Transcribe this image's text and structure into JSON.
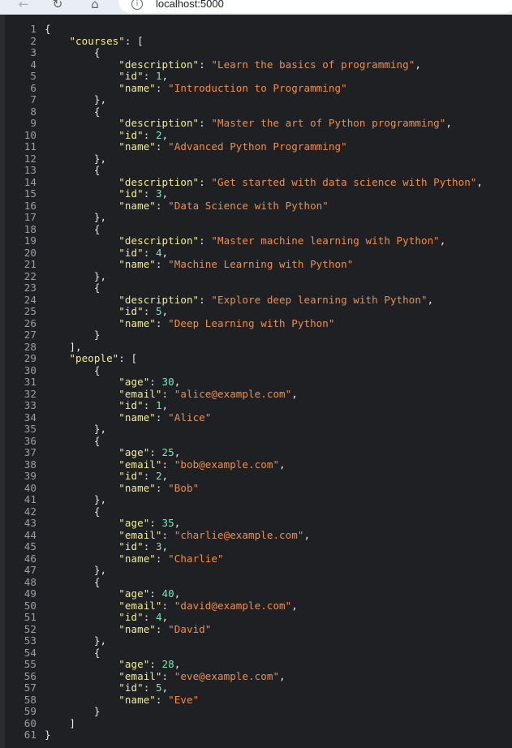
{
  "browser": {
    "url": "localhost:5000",
    "icons": {
      "back": "arrow-left",
      "reload": "reload",
      "home": "home",
      "info": "info"
    }
  },
  "colors": {
    "background": "#1f2023",
    "key": "#f2ee8f",
    "string": "#ef8f4a",
    "number": "#7ee8b9",
    "punctuation": "#e8eaed",
    "line_number": "#9aa0a6"
  },
  "json_viewer": {
    "lines": [
      [
        {
          "t": "p",
          "v": "{"
        }
      ],
      [
        {
          "t": "p",
          "v": "    "
        },
        {
          "t": "k",
          "v": "\"courses\""
        },
        {
          "t": "p",
          "v": ": ["
        }
      ],
      [
        {
          "t": "p",
          "v": "        {"
        }
      ],
      [
        {
          "t": "p",
          "v": "            "
        },
        {
          "t": "k",
          "v": "\"description\""
        },
        {
          "t": "p",
          "v": ": "
        },
        {
          "t": "s",
          "v": "\"Learn the basics of programming\""
        },
        {
          "t": "p",
          "v": ","
        }
      ],
      [
        {
          "t": "p",
          "v": "            "
        },
        {
          "t": "k",
          "v": "\"id\""
        },
        {
          "t": "p",
          "v": ": "
        },
        {
          "t": "n",
          "v": "1"
        },
        {
          "t": "p",
          "v": ","
        }
      ],
      [
        {
          "t": "p",
          "v": "            "
        },
        {
          "t": "k",
          "v": "\"name\""
        },
        {
          "t": "p",
          "v": ": "
        },
        {
          "t": "s",
          "v": "\"Introduction to Programming\""
        }
      ],
      [
        {
          "t": "p",
          "v": "        },"
        }
      ],
      [
        {
          "t": "p",
          "v": "        {"
        }
      ],
      [
        {
          "t": "p",
          "v": "            "
        },
        {
          "t": "k",
          "v": "\"description\""
        },
        {
          "t": "p",
          "v": ": "
        },
        {
          "t": "s",
          "v": "\"Master the art of Python programming\""
        },
        {
          "t": "p",
          "v": ","
        }
      ],
      [
        {
          "t": "p",
          "v": "            "
        },
        {
          "t": "k",
          "v": "\"id\""
        },
        {
          "t": "p",
          "v": ": "
        },
        {
          "t": "n",
          "v": "2"
        },
        {
          "t": "p",
          "v": ","
        }
      ],
      [
        {
          "t": "p",
          "v": "            "
        },
        {
          "t": "k",
          "v": "\"name\""
        },
        {
          "t": "p",
          "v": ": "
        },
        {
          "t": "s",
          "v": "\"Advanced Python Programming\""
        }
      ],
      [
        {
          "t": "p",
          "v": "        },"
        }
      ],
      [
        {
          "t": "p",
          "v": "        {"
        }
      ],
      [
        {
          "t": "p",
          "v": "            "
        },
        {
          "t": "k",
          "v": "\"description\""
        },
        {
          "t": "p",
          "v": ": "
        },
        {
          "t": "s",
          "v": "\"Get started with data science with Python\""
        },
        {
          "t": "p",
          "v": ","
        }
      ],
      [
        {
          "t": "p",
          "v": "            "
        },
        {
          "t": "k",
          "v": "\"id\""
        },
        {
          "t": "p",
          "v": ": "
        },
        {
          "t": "n",
          "v": "3"
        },
        {
          "t": "p",
          "v": ","
        }
      ],
      [
        {
          "t": "p",
          "v": "            "
        },
        {
          "t": "k",
          "v": "\"name\""
        },
        {
          "t": "p",
          "v": ": "
        },
        {
          "t": "s",
          "v": "\"Data Science with Python\""
        }
      ],
      [
        {
          "t": "p",
          "v": "        },"
        }
      ],
      [
        {
          "t": "p",
          "v": "        {"
        }
      ],
      [
        {
          "t": "p",
          "v": "            "
        },
        {
          "t": "k",
          "v": "\"description\""
        },
        {
          "t": "p",
          "v": ": "
        },
        {
          "t": "s",
          "v": "\"Master machine learning with Python\""
        },
        {
          "t": "p",
          "v": ","
        }
      ],
      [
        {
          "t": "p",
          "v": "            "
        },
        {
          "t": "k",
          "v": "\"id\""
        },
        {
          "t": "p",
          "v": ": "
        },
        {
          "t": "n",
          "v": "4"
        },
        {
          "t": "p",
          "v": ","
        }
      ],
      [
        {
          "t": "p",
          "v": "            "
        },
        {
          "t": "k",
          "v": "\"name\""
        },
        {
          "t": "p",
          "v": ": "
        },
        {
          "t": "s",
          "v": "\"Machine Learning with Python\""
        }
      ],
      [
        {
          "t": "p",
          "v": "        },"
        }
      ],
      [
        {
          "t": "p",
          "v": "        {"
        }
      ],
      [
        {
          "t": "p",
          "v": "            "
        },
        {
          "t": "k",
          "v": "\"description\""
        },
        {
          "t": "p",
          "v": ": "
        },
        {
          "t": "s",
          "v": "\"Explore deep learning with Python\""
        },
        {
          "t": "p",
          "v": ","
        }
      ],
      [
        {
          "t": "p",
          "v": "            "
        },
        {
          "t": "k",
          "v": "\"id\""
        },
        {
          "t": "p",
          "v": ": "
        },
        {
          "t": "n",
          "v": "5"
        },
        {
          "t": "p",
          "v": ","
        }
      ],
      [
        {
          "t": "p",
          "v": "            "
        },
        {
          "t": "k",
          "v": "\"name\""
        },
        {
          "t": "p",
          "v": ": "
        },
        {
          "t": "s",
          "v": "\"Deep Learning with Python\""
        }
      ],
      [
        {
          "t": "p",
          "v": "        }"
        }
      ],
      [
        {
          "t": "p",
          "v": "    ],"
        }
      ],
      [
        {
          "t": "p",
          "v": "    "
        },
        {
          "t": "k",
          "v": "\"people\""
        },
        {
          "t": "p",
          "v": ": ["
        }
      ],
      [
        {
          "t": "p",
          "v": "        {"
        }
      ],
      [
        {
          "t": "p",
          "v": "            "
        },
        {
          "t": "k",
          "v": "\"age\""
        },
        {
          "t": "p",
          "v": ": "
        },
        {
          "t": "n",
          "v": "30"
        },
        {
          "t": "p",
          "v": ","
        }
      ],
      [
        {
          "t": "p",
          "v": "            "
        },
        {
          "t": "k",
          "v": "\"email\""
        },
        {
          "t": "p",
          "v": ": "
        },
        {
          "t": "s",
          "v": "\"alice@example.com\""
        },
        {
          "t": "p",
          "v": ","
        }
      ],
      [
        {
          "t": "p",
          "v": "            "
        },
        {
          "t": "k",
          "v": "\"id\""
        },
        {
          "t": "p",
          "v": ": "
        },
        {
          "t": "n",
          "v": "1"
        },
        {
          "t": "p",
          "v": ","
        }
      ],
      [
        {
          "t": "p",
          "v": "            "
        },
        {
          "t": "k",
          "v": "\"name\""
        },
        {
          "t": "p",
          "v": ": "
        },
        {
          "t": "s",
          "v": "\"Alice\""
        }
      ],
      [
        {
          "t": "p",
          "v": "        },"
        }
      ],
      [
        {
          "t": "p",
          "v": "        {"
        }
      ],
      [
        {
          "t": "p",
          "v": "            "
        },
        {
          "t": "k",
          "v": "\"age\""
        },
        {
          "t": "p",
          "v": ": "
        },
        {
          "t": "n",
          "v": "25"
        },
        {
          "t": "p",
          "v": ","
        }
      ],
      [
        {
          "t": "p",
          "v": "            "
        },
        {
          "t": "k",
          "v": "\"email\""
        },
        {
          "t": "p",
          "v": ": "
        },
        {
          "t": "s",
          "v": "\"bob@example.com\""
        },
        {
          "t": "p",
          "v": ","
        }
      ],
      [
        {
          "t": "p",
          "v": "            "
        },
        {
          "t": "k",
          "v": "\"id\""
        },
        {
          "t": "p",
          "v": ": "
        },
        {
          "t": "n",
          "v": "2"
        },
        {
          "t": "p",
          "v": ","
        }
      ],
      [
        {
          "t": "p",
          "v": "            "
        },
        {
          "t": "k",
          "v": "\"name\""
        },
        {
          "t": "p",
          "v": ": "
        },
        {
          "t": "s",
          "v": "\"Bob\""
        }
      ],
      [
        {
          "t": "p",
          "v": "        },"
        }
      ],
      [
        {
          "t": "p",
          "v": "        {"
        }
      ],
      [
        {
          "t": "p",
          "v": "            "
        },
        {
          "t": "k",
          "v": "\"age\""
        },
        {
          "t": "p",
          "v": ": "
        },
        {
          "t": "n",
          "v": "35"
        },
        {
          "t": "p",
          "v": ","
        }
      ],
      [
        {
          "t": "p",
          "v": "            "
        },
        {
          "t": "k",
          "v": "\"email\""
        },
        {
          "t": "p",
          "v": ": "
        },
        {
          "t": "s",
          "v": "\"charlie@example.com\""
        },
        {
          "t": "p",
          "v": ","
        }
      ],
      [
        {
          "t": "p",
          "v": "            "
        },
        {
          "t": "k",
          "v": "\"id\""
        },
        {
          "t": "p",
          "v": ": "
        },
        {
          "t": "n",
          "v": "3"
        },
        {
          "t": "p",
          "v": ","
        }
      ],
      [
        {
          "t": "p",
          "v": "            "
        },
        {
          "t": "k",
          "v": "\"name\""
        },
        {
          "t": "p",
          "v": ": "
        },
        {
          "t": "s",
          "v": "\"Charlie\""
        }
      ],
      [
        {
          "t": "p",
          "v": "        },"
        }
      ],
      [
        {
          "t": "p",
          "v": "        {"
        }
      ],
      [
        {
          "t": "p",
          "v": "            "
        },
        {
          "t": "k",
          "v": "\"age\""
        },
        {
          "t": "p",
          "v": ": "
        },
        {
          "t": "n",
          "v": "40"
        },
        {
          "t": "p",
          "v": ","
        }
      ],
      [
        {
          "t": "p",
          "v": "            "
        },
        {
          "t": "k",
          "v": "\"email\""
        },
        {
          "t": "p",
          "v": ": "
        },
        {
          "t": "s",
          "v": "\"david@example.com\""
        },
        {
          "t": "p",
          "v": ","
        }
      ],
      [
        {
          "t": "p",
          "v": "            "
        },
        {
          "t": "k",
          "v": "\"id\""
        },
        {
          "t": "p",
          "v": ": "
        },
        {
          "t": "n",
          "v": "4"
        },
        {
          "t": "p",
          "v": ","
        }
      ],
      [
        {
          "t": "p",
          "v": "            "
        },
        {
          "t": "k",
          "v": "\"name\""
        },
        {
          "t": "p",
          "v": ": "
        },
        {
          "t": "s",
          "v": "\"David\""
        }
      ],
      [
        {
          "t": "p",
          "v": "        },"
        }
      ],
      [
        {
          "t": "p",
          "v": "        {"
        }
      ],
      [
        {
          "t": "p",
          "v": "            "
        },
        {
          "t": "k",
          "v": "\"age\""
        },
        {
          "t": "p",
          "v": ": "
        },
        {
          "t": "n",
          "v": "28"
        },
        {
          "t": "p",
          "v": ","
        }
      ],
      [
        {
          "t": "p",
          "v": "            "
        },
        {
          "t": "k",
          "v": "\"email\""
        },
        {
          "t": "p",
          "v": ": "
        },
        {
          "t": "s",
          "v": "\"eve@example.com\""
        },
        {
          "t": "p",
          "v": ","
        }
      ],
      [
        {
          "t": "p",
          "v": "            "
        },
        {
          "t": "k",
          "v": "\"id\""
        },
        {
          "t": "p",
          "v": ": "
        },
        {
          "t": "n",
          "v": "5"
        },
        {
          "t": "p",
          "v": ","
        }
      ],
      [
        {
          "t": "p",
          "v": "            "
        },
        {
          "t": "k",
          "v": "\"name\""
        },
        {
          "t": "p",
          "v": ": "
        },
        {
          "t": "s",
          "v": "\"Eve\""
        }
      ],
      [
        {
          "t": "p",
          "v": "        }"
        }
      ],
      [
        {
          "t": "p",
          "v": "    ]"
        }
      ],
      [
        {
          "t": "p",
          "v": "}"
        }
      ]
    ]
  }
}
